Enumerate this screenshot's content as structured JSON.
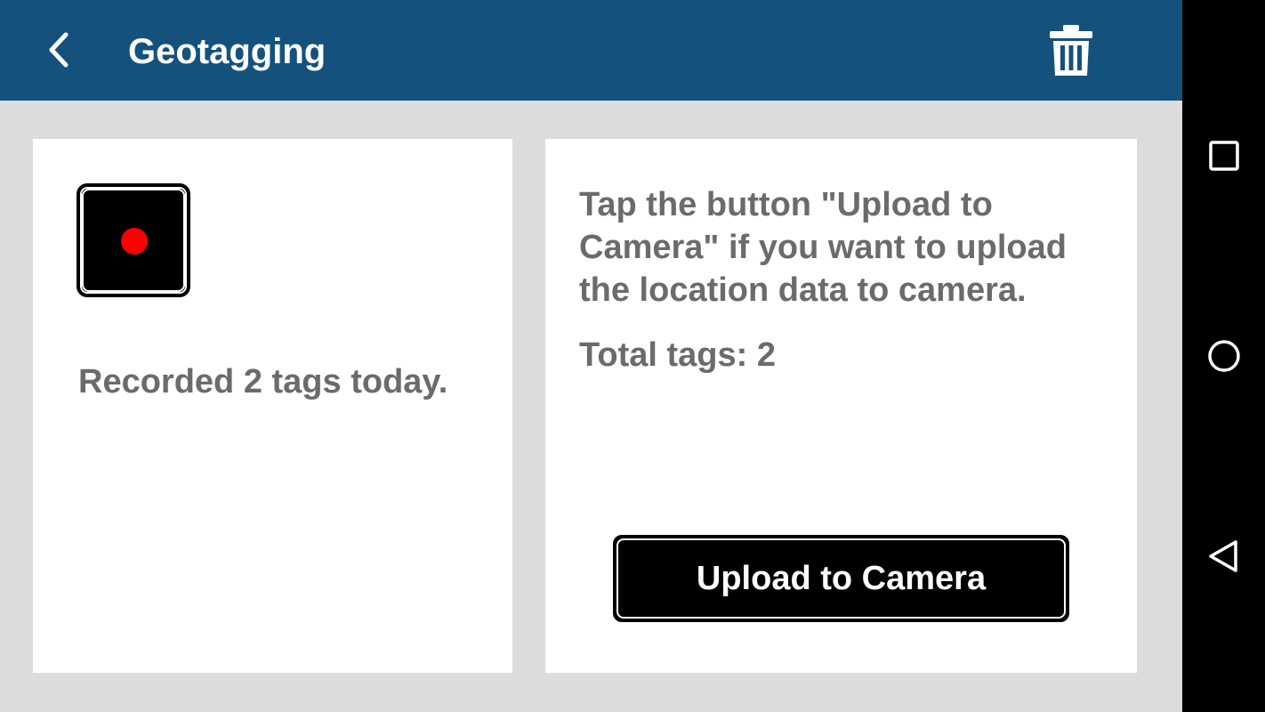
{
  "header": {
    "title": "Geotagging",
    "back_icon": "chevron-left-icon",
    "delete_icon": "trash-icon",
    "background_color": "#14527d"
  },
  "left_panel": {
    "record_button_icon": "record-dot-icon",
    "record_dot_color": "#ff0000",
    "status_text": "Recorded 2 tags today."
  },
  "right_panel": {
    "instruction": "Tap the button \"Upload to Camera\" if you want to upload the location data to camera.",
    "total_tags_text": "Total tags: 2",
    "upload_button_label": "Upload to Camera"
  },
  "system_nav": {
    "recents_icon": "square-icon",
    "home_icon": "circle-icon",
    "back_icon": "triangle-back-icon"
  }
}
